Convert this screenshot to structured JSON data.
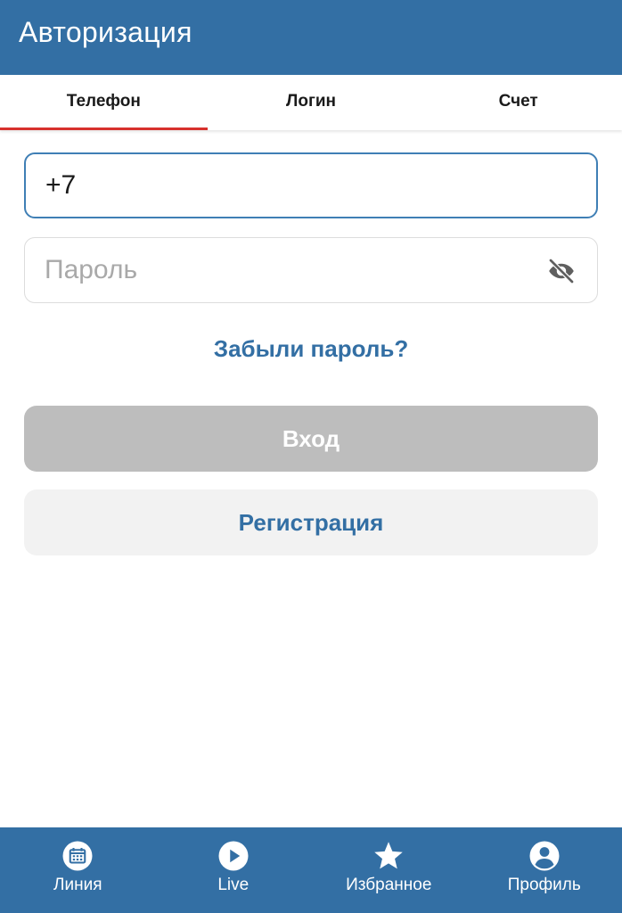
{
  "header": {
    "title": "Авторизация"
  },
  "tabs": [
    {
      "label": "Телефон",
      "active": true
    },
    {
      "label": "Логин",
      "active": false
    },
    {
      "label": "Счет",
      "active": false
    }
  ],
  "form": {
    "phone_value": "+7",
    "password_placeholder": "Пароль",
    "password_toggle_icon": "eye-off-icon",
    "forgot_label": "Забыли пароль?",
    "login_label": "Вход",
    "register_label": "Регистрация"
  },
  "bottom_nav": [
    {
      "label": "Линия",
      "icon": "calendar-icon"
    },
    {
      "label": "Live",
      "icon": "play-icon"
    },
    {
      "label": "Избранное",
      "icon": "star-icon"
    },
    {
      "label": "Профиль",
      "icon": "profile-icon"
    }
  ],
  "colors": {
    "brand": "#336fa4",
    "tab_indicator": "#d7312d",
    "login_disabled": "#bdbdbd",
    "register_bg": "#f2f2f2"
  }
}
